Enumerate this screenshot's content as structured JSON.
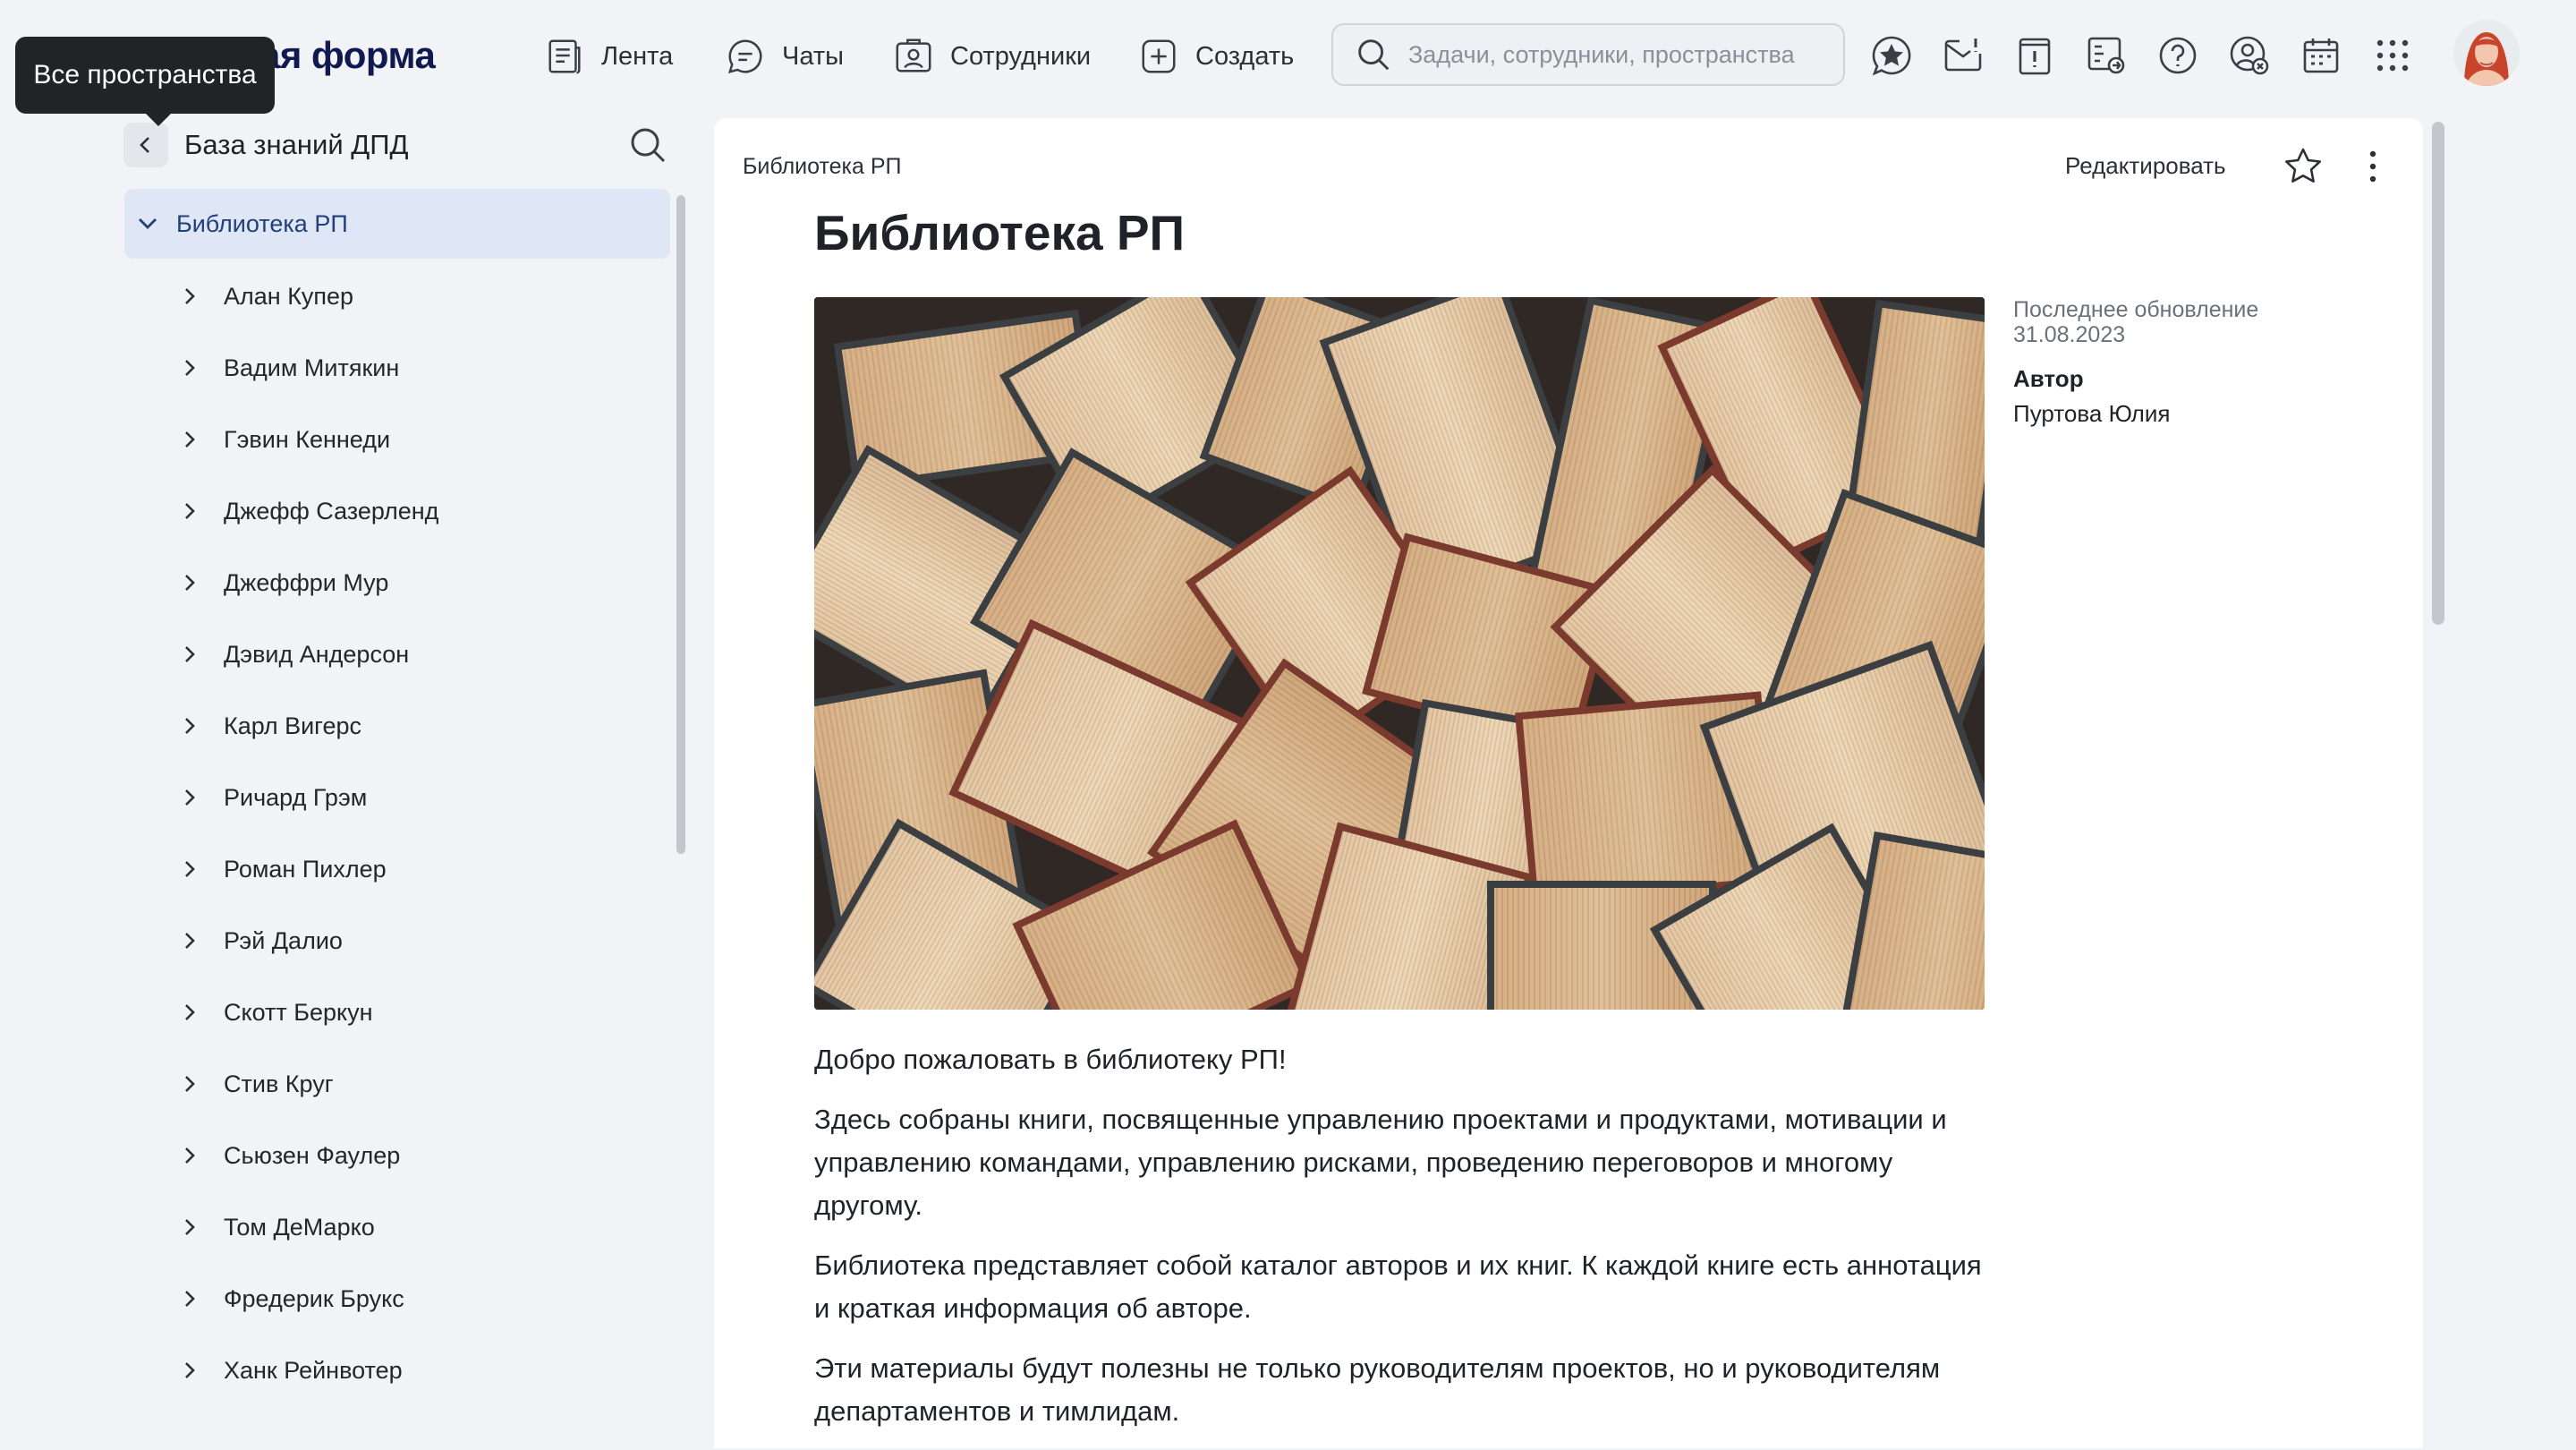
{
  "header": {
    "logo_text": "ая форма",
    "nav": [
      {
        "label": "Лента",
        "icon": "feed-icon"
      },
      {
        "label": "Чаты",
        "icon": "chat-icon"
      },
      {
        "label": "Сотрудники",
        "icon": "employees-icon"
      },
      {
        "label": "Создать",
        "icon": "create-icon"
      }
    ],
    "search_placeholder": "Задачи, сотрудники, пространства",
    "icons": [
      "favorites-icon",
      "mail-icon",
      "alert-icon",
      "tasks-board-icon",
      "help-icon",
      "settings-user-icon",
      "calendar-icon",
      "apps-grid-icon"
    ]
  },
  "tooltip": "Все пространства",
  "sidebar": {
    "title": "База знаний ДПД",
    "root": "Библиотека РП",
    "items": [
      "Алан Купер",
      "Вадим Митякин",
      "Гэвин Кеннеди",
      "Джефф Сазерленд",
      "Джеффри Мур",
      "Дэвид Андерсон",
      "Карл Вигерс",
      "Ричард Грэм",
      "Роман Пихлер",
      "Рэй Далио",
      "Скотт Беркун",
      "Стив Круг",
      "Сьюзен Фаулер",
      "Том ДеМарко",
      "Фредерик Брукс",
      "Ханк Рейнвотер"
    ]
  },
  "page": {
    "breadcrumb": "Библиотека РП",
    "edit_label": "Редактировать",
    "title": "Библиотека РП",
    "meta": {
      "updated_label": "Последнее обновление",
      "updated_date": "31.08.2023",
      "author_label": "Автор",
      "author": "Пуртова Юлия"
    },
    "paragraphs": [
      "Добро пожаловать в библиотеку РП!",
      "Здесь собраны книги, посвященные управлению проектами и продуктами, мотивации и управлению командами, управлению рисками, проведению переговоров и многому другому.",
      "Библиотека представляет собой каталог авторов и их книг. К каждой книге есть аннотация и краткая информация об авторе.",
      "Эти материалы будут полезны не только руководителям проектов, но и руководителям департаментов и тимлидам."
    ]
  },
  "colors": {
    "background": "#f1f3f6",
    "selected_tree_bg": "#dfe6f5",
    "selected_tree_text": "#23407a",
    "logo": "#101a4e"
  }
}
